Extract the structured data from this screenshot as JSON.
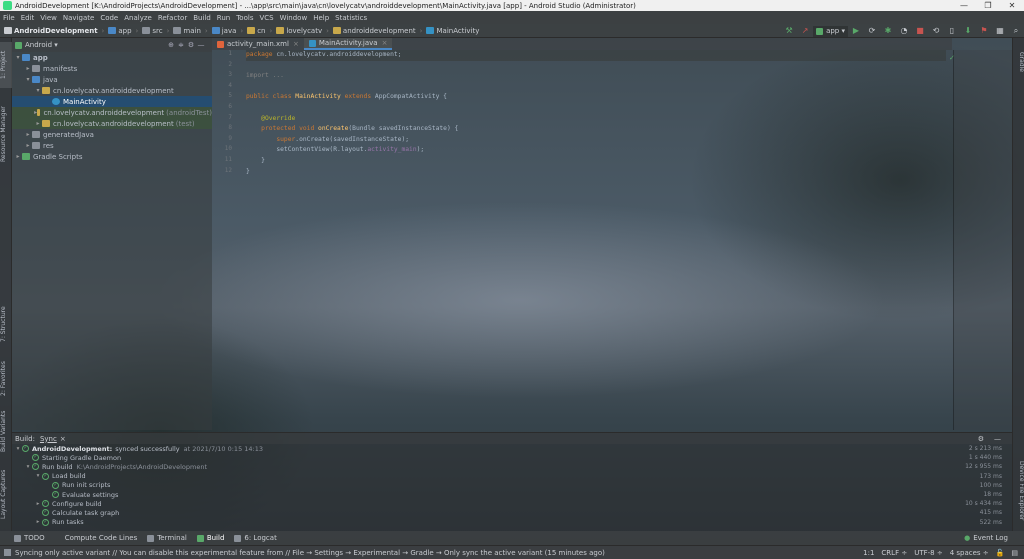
{
  "window": {
    "title": "AndroidDevelopment [K:\\AndroidProjects\\AndroidDevelopment] - ...\\app\\src\\main\\java\\cn\\lovelycatv\\androiddevelopment\\MainActivity.java [app] - Android Studio (Administrator)"
  },
  "menu": [
    "File",
    "Edit",
    "View",
    "Navigate",
    "Code",
    "Analyze",
    "Refactor",
    "Build",
    "Run",
    "Tools",
    "VCS",
    "Window",
    "Help",
    "Statistics"
  ],
  "breadcrumbs": [
    {
      "label": "AndroidDevelopment",
      "icon": "project-icon",
      "color": "#c9ccd1"
    },
    {
      "label": "app",
      "icon": "module-icon",
      "color": "#4a88c7"
    },
    {
      "label": "src",
      "icon": "folder-icon",
      "color": "#8a9099"
    },
    {
      "label": "main",
      "icon": "folder-icon",
      "color": "#8a9099"
    },
    {
      "label": "java",
      "icon": "folder-icon",
      "color": "#4a88c7"
    },
    {
      "label": "cn",
      "icon": "package-icon",
      "color": "#c8a84b"
    },
    {
      "label": "lovelycatv",
      "icon": "package-icon",
      "color": "#c8a84b"
    },
    {
      "label": "androiddevelopment",
      "icon": "package-icon",
      "color": "#c8a84b"
    },
    {
      "label": "MainActivity",
      "icon": "class-icon",
      "color": "#3592c4"
    }
  ],
  "run_toolbar": {
    "config": "app"
  },
  "left_stripe": {
    "project": "1: Project",
    "resource_manager": "Resource Manager",
    "structure": "7: Structure",
    "favorites": "2: Favorites",
    "build_variants": "Build Variants",
    "layout_captures": "Layout Captures"
  },
  "right_stripe": {
    "gradle": "Gradle",
    "device_explorer": "Device File Explorer"
  },
  "project_panel": {
    "view": "Android",
    "tree": [
      {
        "label": "app",
        "depth": 0,
        "arrow": "▾",
        "icon_color": "#4a88c7",
        "bold": true
      },
      {
        "label": "manifests",
        "depth": 1,
        "arrow": "▸",
        "icon_color": "#8a9099"
      },
      {
        "label": "java",
        "depth": 1,
        "arrow": "▾",
        "icon_color": "#4a88c7"
      },
      {
        "label": "cn.lovelycatv.androiddevelopment",
        "depth": 2,
        "arrow": "▾",
        "icon_color": "#c8a84b"
      },
      {
        "label": "MainActivity",
        "depth": 3,
        "arrow": "",
        "icon_color": "#3592c4",
        "selected": true
      },
      {
        "label": "cn.lovelycatv.androiddevelopment",
        "suffix": "(androidTest)",
        "depth": 2,
        "arrow": "▸",
        "icon_color": "#c8a84b",
        "test": true
      },
      {
        "label": "cn.lovelycatv.androiddevelopment",
        "suffix": "(test)",
        "depth": 2,
        "arrow": "▸",
        "icon_color": "#c8a84b",
        "test": true
      },
      {
        "label": "generatedJava",
        "depth": 1,
        "arrow": "▸",
        "icon_color": "#8a9099"
      },
      {
        "label": "res",
        "depth": 1,
        "arrow": "▸",
        "icon_color": "#8a9099"
      },
      {
        "label": "Gradle Scripts",
        "depth": 0,
        "arrow": "▸",
        "icon_color": "#59a869"
      }
    ]
  },
  "editor": {
    "tabs": [
      {
        "label": "activity_main.xml",
        "icon_color": "#e0643c",
        "active": false
      },
      {
        "label": "MainActivity.java",
        "icon_color": "#3592c4",
        "active": true
      }
    ],
    "line_numbers": [
      "1",
      "2",
      "3",
      "4",
      "5",
      "6",
      "7",
      "8",
      "9",
      "10",
      "11",
      "12"
    ],
    "code": {
      "l1_kw": "package",
      "l1_rest": " cn.lovelycatv.androiddevelopment;",
      "l3": "import ...",
      "l5_kw": "public class",
      "l5_cls": " MainActivity ",
      "l5_kw2": "extends",
      "l5_rest": " AppCompatActivity {",
      "l7": "    @Override",
      "l8_kw": "    protected void",
      "l8_cls": " onCreate",
      "l8_rest": "(Bundle savedInstanceState) {",
      "l9_kw": "        super",
      "l9_rest": ".onCreate(savedInstanceState);",
      "l10_rest": "        setContentView(R.layout.",
      "l10_lit": "activity_main",
      "l10_end": ");",
      "l11": "    }",
      "l12": "}"
    }
  },
  "build_panel": {
    "tabs": [
      "Build:",
      "Sync"
    ],
    "rows": [
      {
        "label": "AndroidDevelopment:",
        "extra": "synced successfully",
        "suffix": "at 2021/7/10 0:15 14:13",
        "depth": 0,
        "arrow": "▾",
        "bold": true,
        "duration": "2 s 213 ms"
      },
      {
        "label": "Starting Gradle Daemon",
        "depth": 1,
        "arrow": "",
        "duration": "1 s 440 ms"
      },
      {
        "label": "Run build",
        "suffix": "K:\\AndroidProjects\\AndroidDevelopment",
        "depth": 1,
        "arrow": "▾",
        "duration": "12 s 955 ms"
      },
      {
        "label": "Load build",
        "depth": 2,
        "arrow": "▾",
        "duration": "173 ms"
      },
      {
        "label": "Run init scripts",
        "depth": 3,
        "arrow": "",
        "duration": "100 ms"
      },
      {
        "label": "Evaluate settings",
        "depth": 3,
        "arrow": "",
        "duration": "18 ms"
      },
      {
        "label": "Configure build",
        "depth": 2,
        "arrow": "▸",
        "duration": "10 s 434 ms"
      },
      {
        "label": "Calculate task graph",
        "depth": 2,
        "arrow": "",
        "duration": "415 ms"
      },
      {
        "label": "Run tasks",
        "depth": 2,
        "arrow": "▸",
        "duration": "522 ms"
      }
    ]
  },
  "bottom_tabs": [
    "TODO",
    "Compute Code Lines",
    "Terminal",
    "Build",
    "6: Logcat"
  ],
  "event_log": "Event Log",
  "status": {
    "message": "Syncing only active variant // You can disable this experimental feature from // File → Settings → Experimental → Gradle → Only sync the active variant (15 minutes ago)",
    "position": "1:1",
    "line_sep": "CRLF ÷",
    "encoding": "UTF-8 ÷",
    "indent": "4 spaces ÷"
  }
}
